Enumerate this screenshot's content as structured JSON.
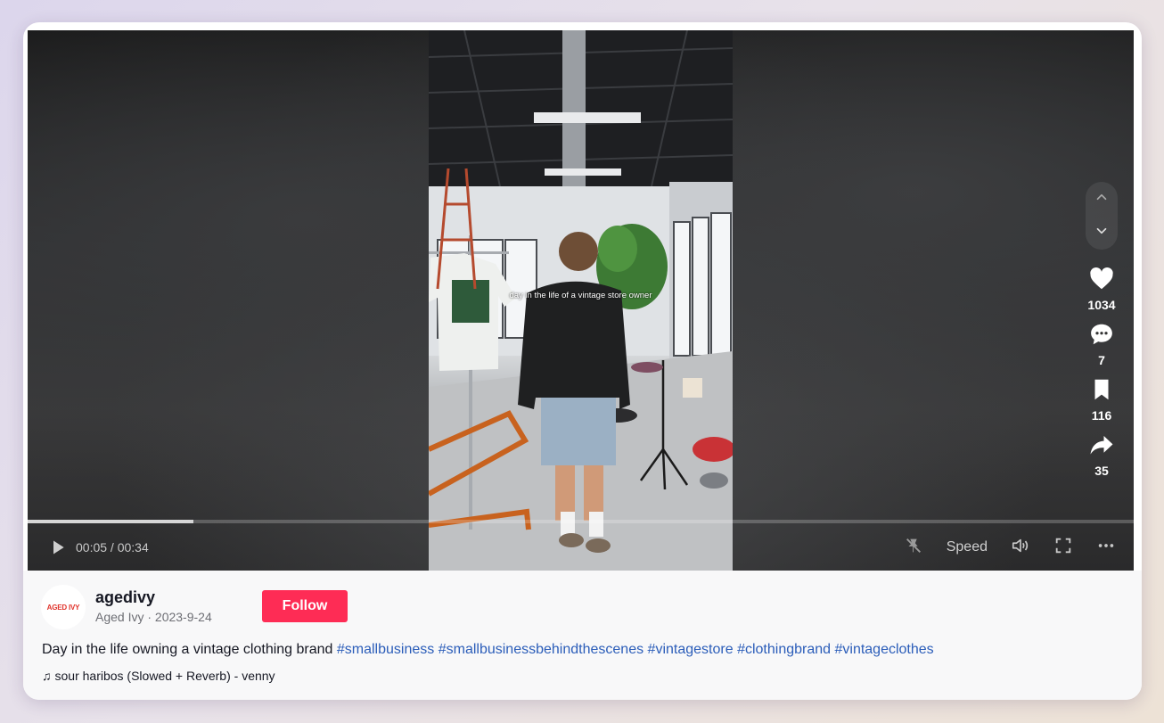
{
  "video": {
    "caption": "day in the life of a vintage store owner",
    "progress_percent": 15
  },
  "controls": {
    "time": "00:05 / 00:34",
    "speed_label": "Speed"
  },
  "actions": {
    "likes": "1034",
    "comments": "7",
    "saves": "116",
    "shares": "35"
  },
  "author": {
    "avatar_text": "AGED IVY",
    "username": "agedivy",
    "subtitle": "Aged Ivy · 2023-9-24",
    "follow_label": "Follow"
  },
  "description": {
    "text": "Day in the life owning a vintage clothing brand ",
    "hashtags": [
      "#smallbusiness",
      "#smallbusinessbehindthescenes",
      "#vintagestore",
      "#clothingbrand",
      "#vintageclothes"
    ]
  },
  "music": {
    "label": "sour haribos (Slowed + Reverb) - venny"
  },
  "colors": {
    "follow": "#fe2c55",
    "hashtag": "#2b5db9"
  }
}
